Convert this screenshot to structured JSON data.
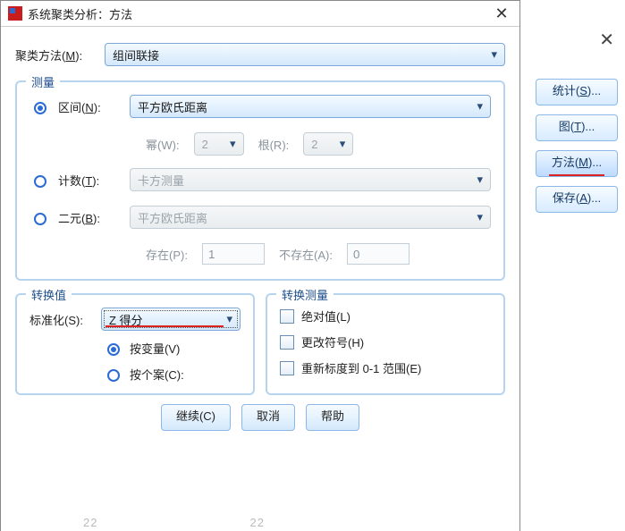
{
  "window": {
    "title": "系统聚类分析：方法"
  },
  "method": {
    "label_pre": "聚类方法(",
    "label_ul": "M",
    "label_post": "):",
    "value": "组间联接"
  },
  "measure": {
    "legend": "测量",
    "interval": {
      "pre": "区间(",
      "ul": "N",
      "post": "):",
      "value": "平方欧氏距离"
    },
    "power": {
      "pre": "幂(",
      "ul": "W",
      "post": "):",
      "value": "2"
    },
    "root": {
      "pre": "根(",
      "ul": "R",
      "post": "):",
      "value": "2"
    },
    "count": {
      "pre": "计数(",
      "ul": "T",
      "post": "):",
      "value": "卡方测量"
    },
    "binary": {
      "pre": "二元(",
      "ul": "B",
      "post": "):",
      "value": "平方欧氏距离"
    },
    "present": {
      "pre": "存在(",
      "ul": "P",
      "post": "):",
      "value": "1"
    },
    "absent": {
      "pre": "不存在(",
      "ul": "A",
      "post": "):",
      "value": "0"
    }
  },
  "transformValues": {
    "legend": "转换值",
    "std": {
      "pre": "标准化(",
      "ul": "S",
      "post": "):",
      "value": "Z 得分"
    },
    "byVar": {
      "text_pre": "按变量(",
      "ul": "V",
      "text_post": ")"
    },
    "byCase": {
      "text_pre": "按个案(",
      "ul": "C",
      "text_post": "):"
    }
  },
  "transformMeasure": {
    "legend": "转换测量",
    "abs": {
      "pre": "绝对值(",
      "ul": "L",
      "post": ")"
    },
    "sign": {
      "pre": "更改符号(",
      "ul": "H",
      "post": ")"
    },
    "range": {
      "pre": "重新标度到 0-1 范围(",
      "ul": "E",
      "post": ")"
    }
  },
  "buttons": {
    "continue": {
      "pre": "继续(",
      "ul": "C",
      "post": ")"
    },
    "cancel": "取消",
    "help": "帮助"
  },
  "arrow": "▾",
  "side": {
    "close": "✕",
    "stats": {
      "pre": "统计(",
      "ul": "S",
      "post": ")..."
    },
    "plots": {
      "pre": "图(",
      "ul": "T",
      "post": ")..."
    },
    "method": {
      "pre": "方法(",
      "ul": "M",
      "post": ")..."
    },
    "save": {
      "pre": "保存(",
      "ul": "A",
      "post": ")..."
    }
  },
  "footer": {
    "a": "22",
    "b": "22"
  }
}
